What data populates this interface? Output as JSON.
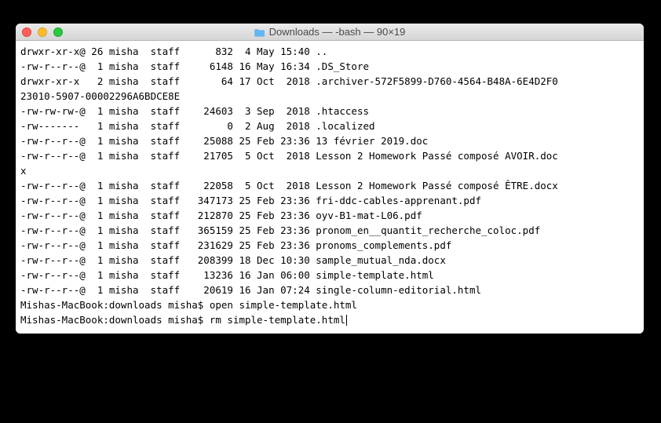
{
  "window": {
    "title": "Downloads — -bash — 90×19"
  },
  "listing": [
    {
      "perm": "drwxr-xr-x@",
      "links": "26",
      "owner": "misha",
      "group": "staff",
      "size": "832",
      "date": " 4 May 15:40",
      "name": ".."
    },
    {
      "perm": "-rw-r--r--@",
      "links": " 1",
      "owner": "misha",
      "group": "staff",
      "size": "6148",
      "date": "16 May 16:34",
      "name": ".DS_Store"
    },
    {
      "perm": "drwxr-xr-x ",
      "links": " 2",
      "owner": "misha",
      "group": "staff",
      "size": "64",
      "date": "17 Oct  2018",
      "name": ".archiver-572F5899-D760-4564-B48A-6E4D2F0"
    },
    {
      "cont": "23010-5907-00002296A6BDCE8E"
    },
    {
      "perm": "-rw-rw-rw-@",
      "links": " 1",
      "owner": "misha",
      "group": "staff",
      "size": "24603",
      "date": " 3 Sep  2018",
      "name": ".htaccess"
    },
    {
      "perm": "-rw------- ",
      "links": " 1",
      "owner": "misha",
      "group": "staff",
      "size": "0",
      "date": " 2 Aug  2018",
      "name": ".localized"
    },
    {
      "perm": "-rw-r--r--@",
      "links": " 1",
      "owner": "misha",
      "group": "staff",
      "size": "25088",
      "date": "25 Feb 23:36",
      "name": "13 février 2019.doc"
    },
    {
      "perm": "-rw-r--r--@",
      "links": " 1",
      "owner": "misha",
      "group": "staff",
      "size": "21705",
      "date": " 5 Oct  2018",
      "name": "Lesson 2 Homework Passé composé AVOIR.doc"
    },
    {
      "cont": "x"
    },
    {
      "perm": "-rw-r--r--@",
      "links": " 1",
      "owner": "misha",
      "group": "staff",
      "size": "22058",
      "date": " 5 Oct  2018",
      "name": "Lesson 2 Homework Passé composé ÊTRE.docx"
    },
    {
      "perm": "-rw-r--r--@",
      "links": " 1",
      "owner": "misha",
      "group": "staff",
      "size": "347173",
      "date": "25 Feb 23:36",
      "name": "fri-ddc-cables-apprenant.pdf"
    },
    {
      "perm": "-rw-r--r--@",
      "links": " 1",
      "owner": "misha",
      "group": "staff",
      "size": "212870",
      "date": "25 Feb 23:36",
      "name": "oyv-B1-mat-L06.pdf"
    },
    {
      "perm": "-rw-r--r--@",
      "links": " 1",
      "owner": "misha",
      "group": "staff",
      "size": "365159",
      "date": "25 Feb 23:36",
      "name": "pronom_en__quantit_recherche_coloc.pdf"
    },
    {
      "perm": "-rw-r--r--@",
      "links": " 1",
      "owner": "misha",
      "group": "staff",
      "size": "231629",
      "date": "25 Feb 23:36",
      "name": "pronoms_complements.pdf"
    },
    {
      "perm": "-rw-r--r--@",
      "links": " 1",
      "owner": "misha",
      "group": "staff",
      "size": "208399",
      "date": "18 Dec 10:30",
      "name": "sample_mutual_nda.docx"
    },
    {
      "perm": "-rw-r--r--@",
      "links": " 1",
      "owner": "misha",
      "group": "staff",
      "size": "13236",
      "date": "16 Jan 06:00",
      "name": "simple-template.html"
    },
    {
      "perm": "-rw-r--r--@",
      "links": " 1",
      "owner": "misha",
      "group": "staff",
      "size": "20619",
      "date": "16 Jan 07:24",
      "name": "single-column-editorial.html"
    }
  ],
  "prompts": [
    {
      "prompt": "Mishas-MacBook:downloads misha$ ",
      "command": "open simple-template.html"
    },
    {
      "prompt": "Mishas-MacBook:downloads misha$ ",
      "command": "rm simple-template.html"
    }
  ]
}
